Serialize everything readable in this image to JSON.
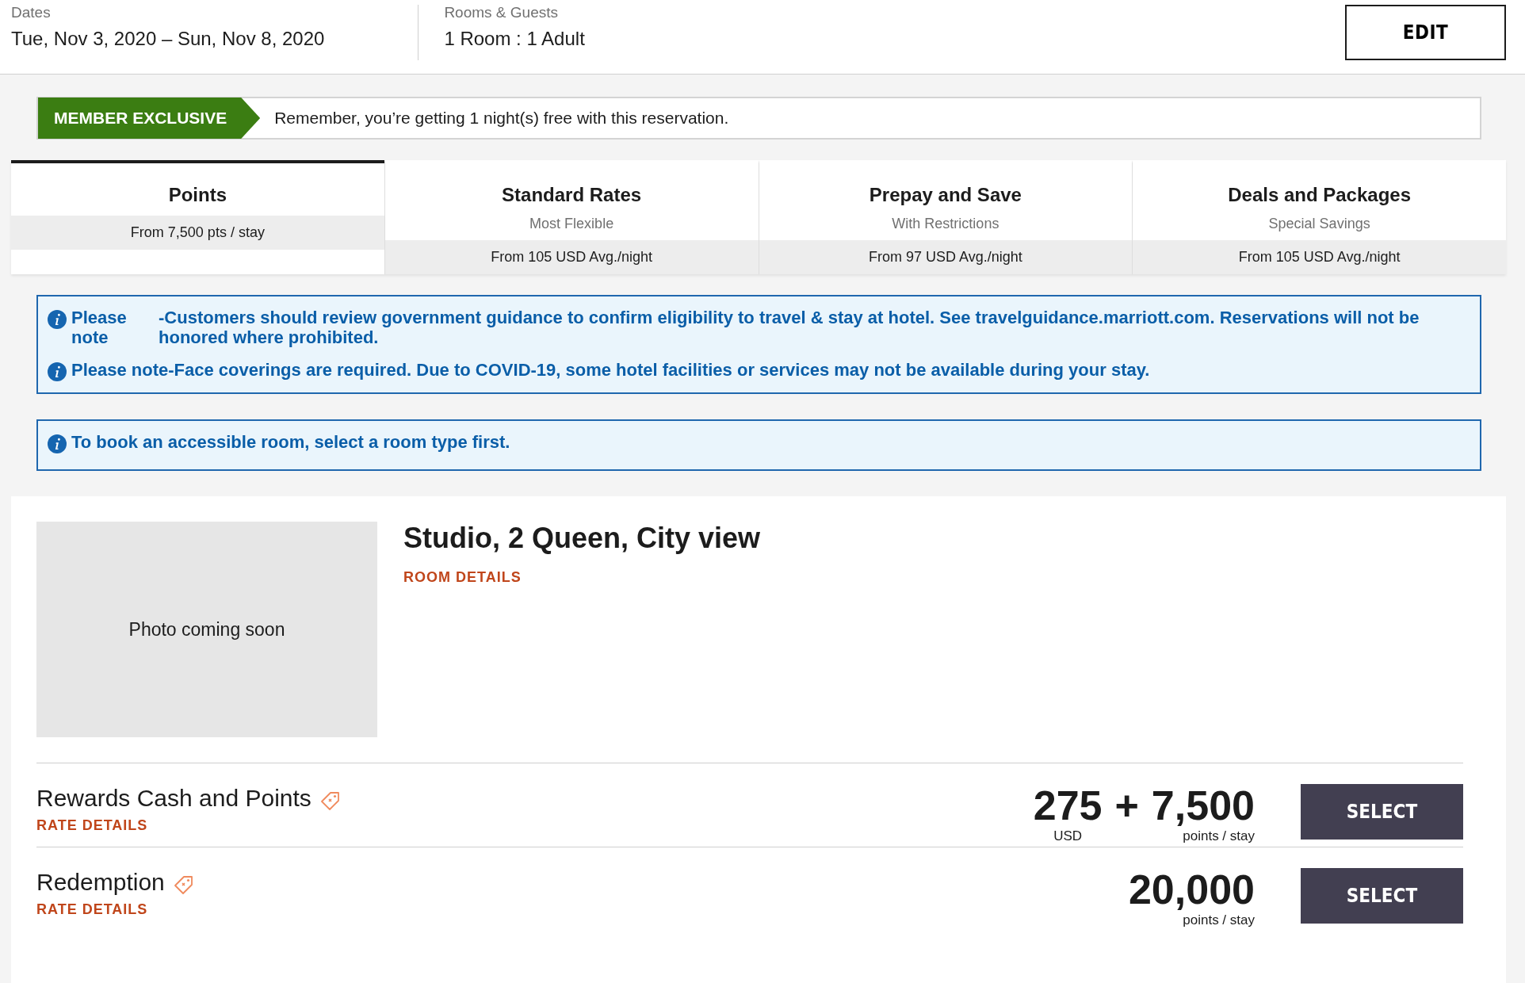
{
  "summary": {
    "dates_label": "Dates",
    "dates": "Tue, Nov 3, 2020 – Sun, Nov 8, 2020",
    "guests_label": "Rooms & Guests",
    "guests": "1 Room : 1 Adult",
    "edit": "EDIT"
  },
  "banner": {
    "tag": "MEMBER EXCLUSIVE",
    "text": "Remember, you’re getting 1 night(s) free with this reservation."
  },
  "tabs": [
    {
      "title": "Points",
      "price": "From 7,500 pts / stay",
      "selected": true
    },
    {
      "title": "Standard Rates",
      "subtitle": "Most Flexible",
      "price": "From 105 USD Avg./night",
      "selected": false
    },
    {
      "title": "Prepay and Save",
      "subtitle": "With Restrictions",
      "price": "From 97 USD Avg./night",
      "selected": false
    },
    {
      "title": "Deals and Packages",
      "subtitle": "Special Savings",
      "price": "From 105 USD Avg./night",
      "selected": false
    }
  ],
  "alerts": [
    {
      "messages": [
        {
          "label": "Please note",
          "text": "-Customers should review government guidance to confirm eligibility to travel & stay at hotel. See travelguidance.marriott.com. Reservations will not be honored where prohibited."
        },
        {
          "text": "Please note-Face coverings are required. Due to COVID-19, some hotel facilities or services may not be available during your stay."
        }
      ]
    },
    {
      "messages": [
        {
          "text": "To book an accessible room, select a room type first."
        }
      ]
    }
  ],
  "room": {
    "photo_text": "Photo coming soon",
    "title": "Studio, 2 Queen, City view",
    "details_link": "ROOM DETAILS",
    "rates": [
      {
        "name": "Rewards Cash and Points",
        "link": "RATE DETAILS",
        "prices": [
          {
            "amount": "275",
            "unit": "USD"
          },
          {
            "amount": "7,500",
            "unit": "points / stay"
          }
        ],
        "joiner": "+",
        "button": "SELECT"
      },
      {
        "name": "Redemption",
        "link": "RATE DETAILS",
        "prices": [
          {
            "amount": "20,000",
            "unit": "points / stay"
          }
        ],
        "button": "SELECT"
      }
    ]
  }
}
